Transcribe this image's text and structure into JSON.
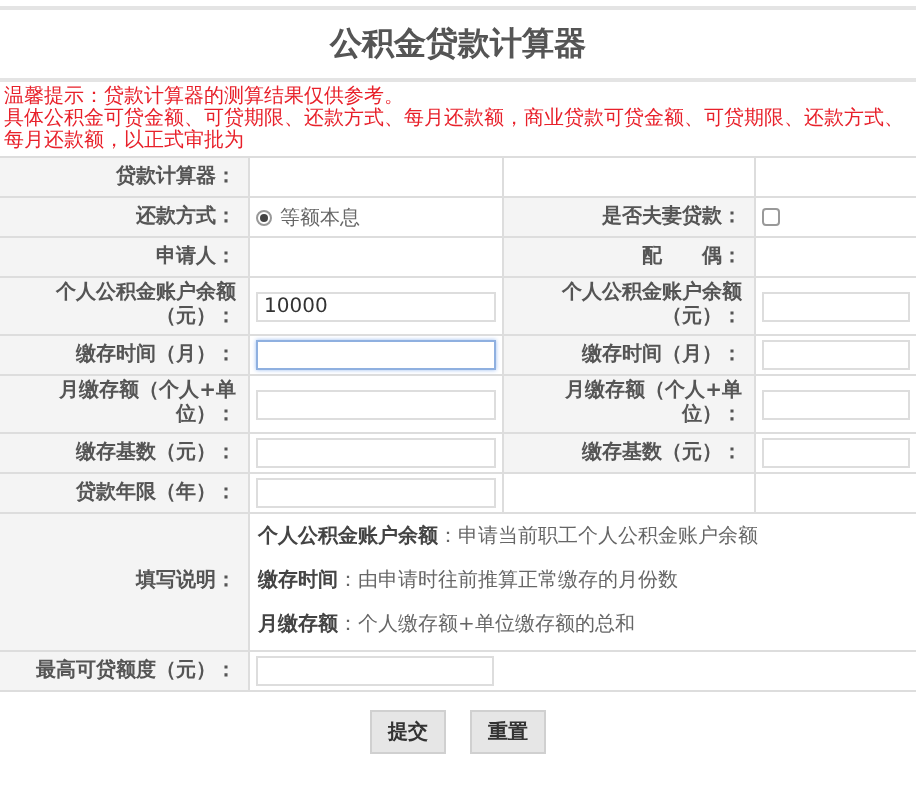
{
  "title": "公积金贷款计算器",
  "notice": [
    "温馨提示：贷款计算器的测算结果仅供参考。",
    "具体公积金可贷金额、可贷期限、还款方式、每月还款额，商业贷款可贷金额、可贷期限、还款方式、每月还款额，以正式审批为"
  ],
  "rows": [
    {
      "cells": [
        {
          "kind": "label",
          "text": "贷款计算器："
        },
        {
          "kind": "blank"
        },
        {
          "kind": "blank"
        },
        {
          "kind": "blank"
        }
      ]
    },
    {
      "cells": [
        {
          "kind": "label",
          "text": "还款方式："
        },
        {
          "kind": "radio",
          "label": "等额本息",
          "selected": true
        },
        {
          "kind": "label",
          "text": "是否夫妻贷款："
        },
        {
          "kind": "checkbox",
          "checked": false
        }
      ]
    },
    {
      "cells": [
        {
          "kind": "label",
          "text": "申请人："
        },
        {
          "kind": "blank"
        },
        {
          "kind": "label",
          "text": "配　　偶："
        },
        {
          "kind": "blank"
        }
      ]
    },
    {
      "cells": [
        {
          "kind": "label",
          "text": "个人公积金账户余额（元）："
        },
        {
          "kind": "input",
          "value": "10000",
          "focused": false
        },
        {
          "kind": "label",
          "text": "个人公积金账户余额（元）："
        },
        {
          "kind": "input",
          "focused": false
        }
      ]
    },
    {
      "cells": [
        {
          "kind": "label",
          "text": "缴存时间（月）："
        },
        {
          "kind": "input",
          "focused": true
        },
        {
          "kind": "label",
          "text": "缴存时间（月）："
        },
        {
          "kind": "input",
          "focused": false
        }
      ]
    },
    {
      "cells": [
        {
          "kind": "label",
          "text": "月缴存额（个人+单位）："
        },
        {
          "kind": "input",
          "focused": false
        },
        {
          "kind": "label",
          "text": "月缴存额（个人+单位）："
        },
        {
          "kind": "input",
          "focused": false
        }
      ]
    },
    {
      "cells": [
        {
          "kind": "label",
          "text": "缴存基数（元）："
        },
        {
          "kind": "input",
          "focused": false
        },
        {
          "kind": "label",
          "text": "缴存基数（元）："
        },
        {
          "kind": "input",
          "focused": false
        }
      ]
    },
    {
      "cells": [
        {
          "kind": "label",
          "text": "贷款年限（年）："
        },
        {
          "kind": "input",
          "focused": false
        },
        {
          "kind": "blank"
        },
        {
          "kind": "blank"
        }
      ]
    },
    {
      "cells": [
        {
          "kind": "label",
          "text": "填写说明："
        },
        {
          "kind": "notes",
          "items": [
            "**个人公积金账户余额**：申请当前职工个人公积金账户余额",
            "**缴存时间**：由申请时往前推算正常缴存的月份数",
            "**月缴存额**：个人缴存额+单位缴存额的总和"
          ]
        }
      ]
    },
    {
      "cells": [
        {
          "kind": "label",
          "text": "最高可贷额度（元）："
        },
        {
          "kind": "input",
          "focused": false
        }
      ]
    }
  ],
  "buttons": [
    "提交",
    "重置"
  ]
}
